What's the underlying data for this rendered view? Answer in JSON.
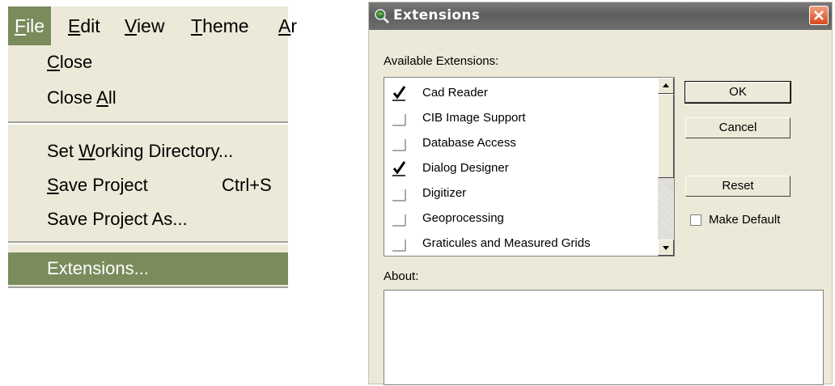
{
  "menubar": {
    "items": [
      {
        "label": "File",
        "mnemonic": "F"
      },
      {
        "label": "Edit",
        "mnemonic": "E"
      },
      {
        "label": "View",
        "mnemonic": "V"
      },
      {
        "label": "Theme",
        "mnemonic": "T"
      },
      {
        "label": "Ar",
        "mnemonic": "A"
      }
    ]
  },
  "file_menu": {
    "close": {
      "label": "Close"
    },
    "close_all": {
      "label": "Close All"
    },
    "set_working_dir": {
      "label": "Set Working Directory..."
    },
    "save_project": {
      "label": "Save Project",
      "shortcut": "Ctrl+S"
    },
    "save_project_as": {
      "label": "Save Project As..."
    },
    "extensions": {
      "label": "Extensions..."
    }
  },
  "dialog": {
    "title": "Extensions",
    "available_label": "Available Extensions:",
    "extensions": [
      {
        "name": "Cad Reader",
        "checked": true
      },
      {
        "name": "CIB Image Support",
        "checked": false
      },
      {
        "name": "Database Access",
        "checked": false
      },
      {
        "name": "Dialog Designer",
        "checked": true
      },
      {
        "name": "Digitizer",
        "checked": false
      },
      {
        "name": "Geoprocessing",
        "checked": false
      },
      {
        "name": "Graticules and Measured Grids",
        "checked": false
      }
    ],
    "buttons": {
      "ok": "OK",
      "cancel": "Cancel",
      "reset": "Reset"
    },
    "make_default_label": "Make Default",
    "make_default_checked": false,
    "about_label": "About:",
    "about_text": ""
  },
  "colors": {
    "menu_highlight": "#7a8b5c",
    "menu_background": "#ece9d8",
    "dialog_background": "#ece9d8",
    "titlebar": "#666666",
    "close_button": "#d84a1c"
  },
  "icons": {
    "title_icon": "magnifier-globe-icon",
    "close": "close-icon",
    "check": "checkmark-icon",
    "scroll_up": "scroll-up-arrow-icon",
    "scroll_down": "scroll-down-arrow-icon"
  }
}
